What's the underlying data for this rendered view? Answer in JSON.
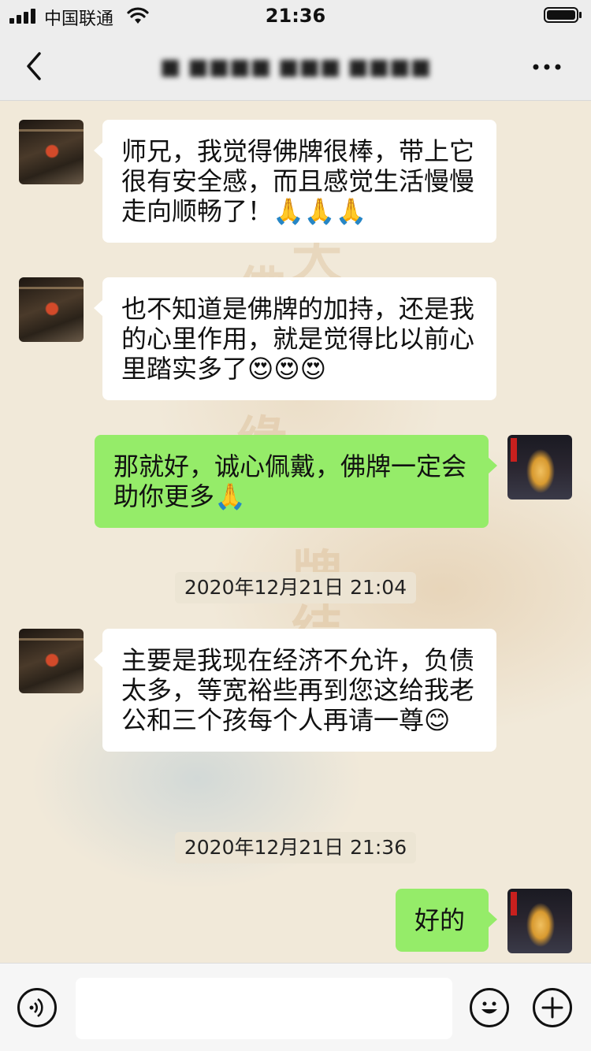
{
  "status_bar": {
    "carrier": "中国联通",
    "time": "21:36",
    "signal_icon": "signal-bars-icon",
    "wifi_icon": "wifi-icon",
    "battery_icon": "battery-full-icon"
  },
  "nav": {
    "title": "■ ■■■■ ■■■ ■■■■",
    "back_icon": "chevron-left-icon",
    "more_icon": "more-dots-icon"
  },
  "messages": [
    {
      "side": "them",
      "text": "师兄，我觉得佛牌很棒，带上它很有安全感，而且感觉生活慢慢走向顺畅了！🙏🙏🙏"
    },
    {
      "side": "them",
      "text": "也不知道是佛牌的加持，还是我的心里作用，就是觉得比以前心里踏实多了😍😍😍"
    },
    {
      "side": "me",
      "text": "那就好，诚心佩戴，佛牌一定会助你更多🙏"
    },
    {
      "timestamp": "2020年12月21日 21:04"
    },
    {
      "side": "them",
      "text": "主要是我现在经济不允许，负债太多，等宽裕些再到您这给我老公和三个孩每个人再请一尊😊"
    },
    {
      "timestamp": "2020年12月21日 21:36"
    },
    {
      "side": "me",
      "text": "好的"
    }
  ],
  "input_bar": {
    "voice_icon": "voice-input-icon",
    "emoji_icon": "emoji-icon",
    "plus_icon": "plus-icon",
    "placeholder": ""
  }
}
